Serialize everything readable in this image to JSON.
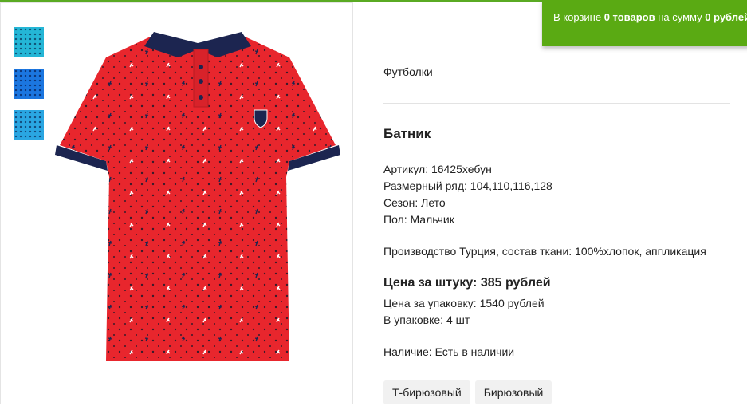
{
  "cart": {
    "prefix": "В корзине ",
    "count": "0 товаров",
    "middle": " на сумму ",
    "sum": "0 рублей"
  },
  "gallery": {
    "thumbnails": [
      {
        "name": "thumb-turquoise",
        "color": "#24b6d6"
      },
      {
        "name": "thumb-blue",
        "color": "#1b76e0"
      },
      {
        "name": "thumb-light-blue",
        "color": "#2aa6e2"
      }
    ],
    "main_color": "#e8262d",
    "collar_color": "#1c2550"
  },
  "product": {
    "category": "Футболки",
    "title": "Батник",
    "article": "Артикул: 16425хебун",
    "sizes": "Размерный ряд: 104,110,116,128",
    "season": "Сезон: Лето",
    "gender": "Пол: Мальчик",
    "description": "Производство Турция, состав ткани: 100%хлопок, аппликация",
    "price_unit": "Цена за штуку: 385 рублей",
    "price_pack": "Цена за упаковку: 1540 рублей",
    "pack_qty": "В упаковке: 4 шт",
    "availability": "Наличие: Есть в наличии",
    "colors": [
      "Т-бирюзовый",
      "Бирюзовый"
    ]
  },
  "theme": {
    "accent": "#5aaa13"
  }
}
